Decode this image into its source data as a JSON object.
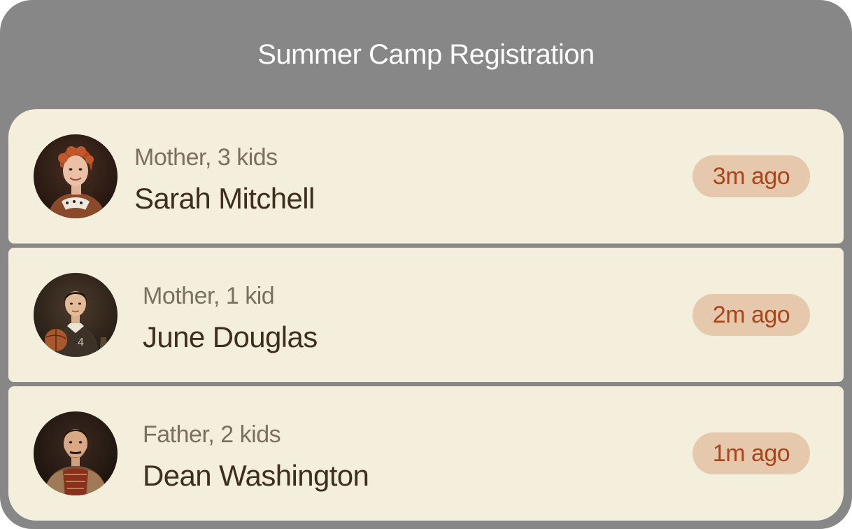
{
  "header": {
    "title": "Summer Camp Registration"
  },
  "registrations": [
    {
      "subtitle": "Mother, 3 kids",
      "name": "Sarah Mitchell",
      "time": "3m ago",
      "avatar_icon": "portrait-woman-red-hair"
    },
    {
      "subtitle": "Mother, 1 kid",
      "name": "June Douglas",
      "time": "2m ago",
      "avatar_icon": "portrait-boy-with-ball"
    },
    {
      "subtitle": "Father, 2 kids",
      "name": "Dean Washington",
      "time": "1m ago",
      "avatar_icon": "portrait-bearded-man"
    }
  ],
  "colors": {
    "frame": "#878787",
    "row_background": "#f4eedd",
    "badge_background": "#e6c9ac",
    "badge_text": "#a8471d",
    "name_text": "#3e2e1e",
    "subtitle_text": "#7b705f"
  }
}
